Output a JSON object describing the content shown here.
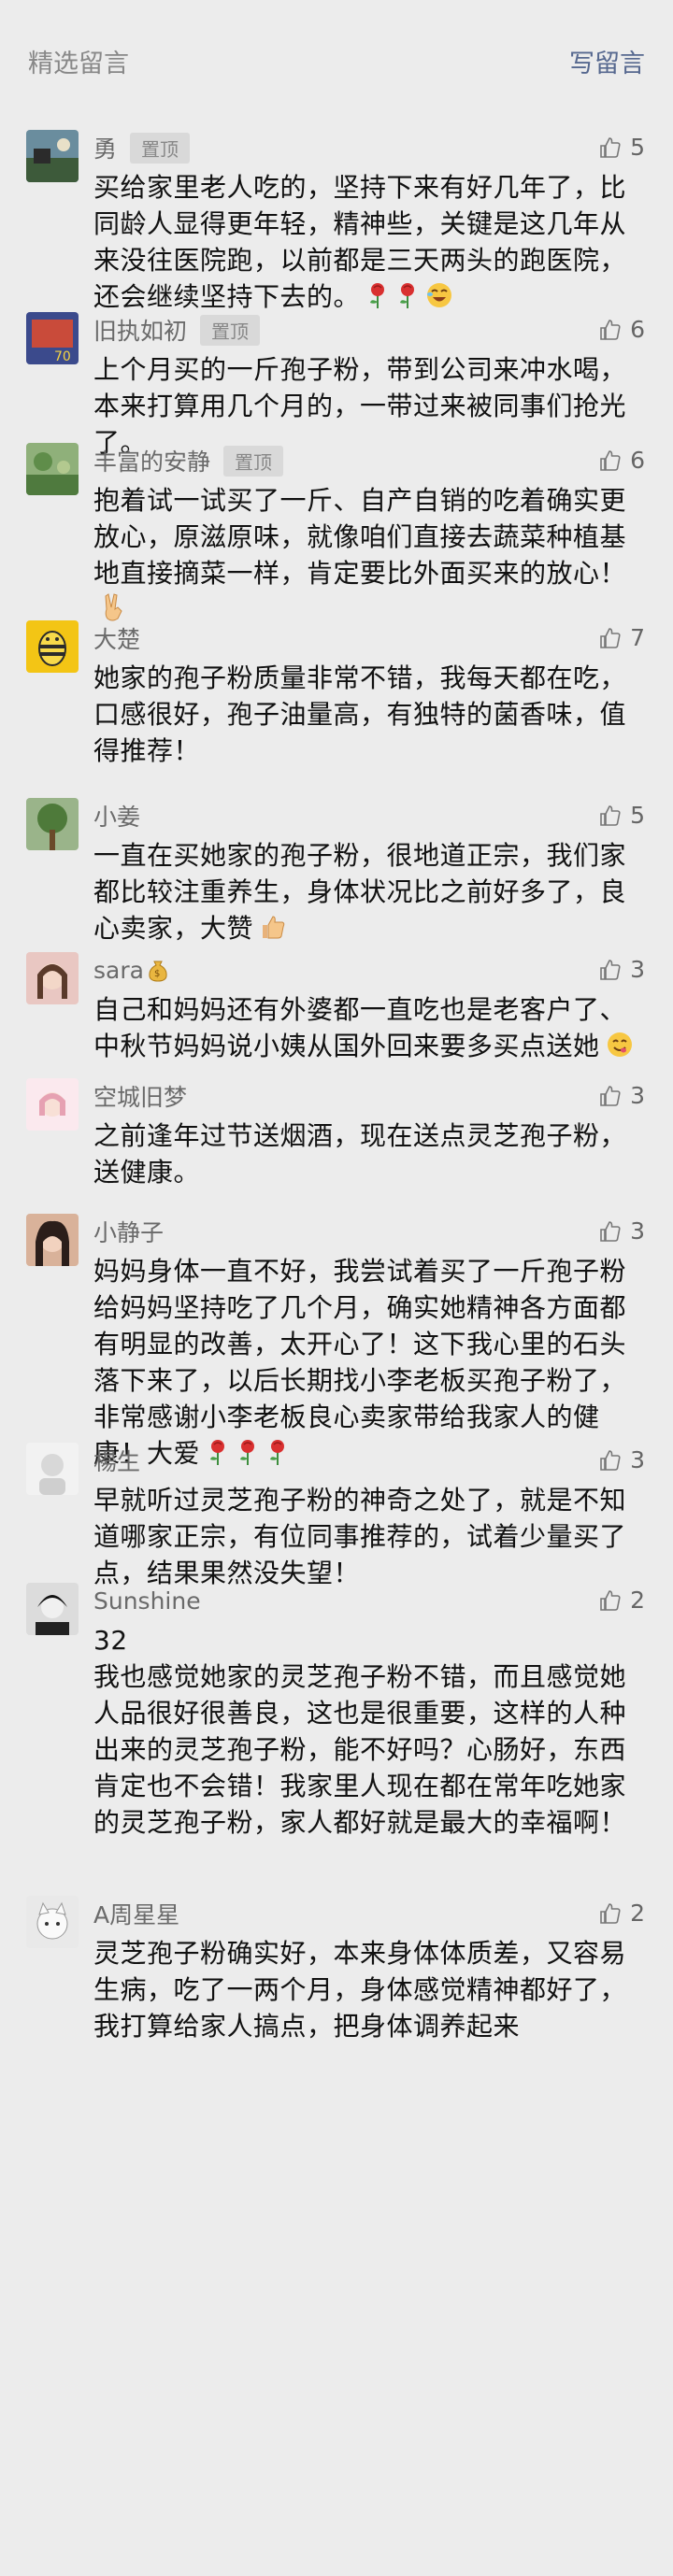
{
  "header": {
    "title": "精选留言",
    "write": "写留言"
  },
  "comments": [
    {
      "name": "勇",
      "pinned": "置顶",
      "likes": "5",
      "text": "买给家里老人吃的，坚持下来有好几年了，比同龄人显得更年轻，精神些，关键是这几年从来没往医院跑，以前都是三天两头的跑医院，还会继续坚持下去的。",
      "avatar": "avatar-landscape-icon",
      "emojis": [
        "rose-icon",
        "rose-icon",
        "laugh-icon"
      ]
    },
    {
      "name": "旧执如初",
      "pinned": "置顶",
      "likes": "6",
      "text": "上个月买的一斤孢子粉，带到公司来冲水喝，本来打算用几个月的，一带过来被同事们抢光了。",
      "avatar": "avatar-game-icon",
      "emojis": []
    },
    {
      "name": "丰富的安静",
      "pinned": "置顶",
      "likes": "6",
      "text": "抱着试一试买了一斤、自产自销的吃着确实更放心，原滋原味，就像咱们直接去蔬菜种植基地直接摘菜一样，肯定要比外面买来的放心！",
      "avatar": "avatar-garden-icon",
      "emojis": [
        "victory-hand-icon"
      ]
    },
    {
      "name": "大楚",
      "pinned": "",
      "likes": "7",
      "text": "她家的孢子粉质量非常不错，我每天都在吃，口感很好，孢子油量高，有独特的菌香味，值得推荐！",
      "avatar": "avatar-bee-icon",
      "emojis": []
    },
    {
      "name": "小姜",
      "pinned": "",
      "likes": "5",
      "text": "一直在买她家的孢子粉，很地道正宗，我们家都比较注重养生，身体状况比之前好多了，良心卖家，大赞",
      "avatar": "avatar-tree-icon",
      "emojis": [
        "thumbs-up-icon"
      ]
    },
    {
      "name": "sara",
      "pinned": "",
      "likes": "3",
      "text": "自己和妈妈还有外婆都一直吃也是老客户了、中秋节妈妈说小姨从国外回来要多买点送她",
      "avatar": "avatar-girl-icon",
      "emojis": [
        "yum-face-icon"
      ],
      "name_emoji": "money-bag-icon"
    },
    {
      "name": "空城旧梦",
      "pinned": "",
      "likes": "3",
      "text": "之前逢年过节送烟酒，现在送点灵芝孢子粉，送健康。",
      "avatar": "avatar-pink-girl-icon",
      "emojis": []
    },
    {
      "name": "小静子",
      "pinned": "",
      "likes": "3",
      "text": "妈妈身体一直不好，我尝试着买了一斤孢子粉给妈妈坚持吃了几个月，确实她精神各方面都有明显的改善，太开心了！这下我心里的石头落下来了，以后长期找小李老板买孢子粉了，非常感谢小李老板良心卖家带给我家人的健康！大爱",
      "avatar": "avatar-woman-icon",
      "emojis": [
        "rose-icon",
        "rose-icon",
        "rose-icon"
      ]
    },
    {
      "name": "楊生",
      "pinned": "",
      "likes": "3",
      "text": "早就听过灵芝孢子粉的神奇之处了，就是不知道哪家正宗，有位同事推荐的，试着少量买了点，结果果然没失望！",
      "avatar": "avatar-white-icon",
      "emojis": []
    },
    {
      "name": "Sunshine",
      "pinned": "",
      "likes": "2",
      "text": "32\n我也感觉她家的灵芝孢子粉不错，而且感觉她人品很好很善良，这也是很重要，这样的人种出来的灵芝孢子粉，能不好吗？心肠好，东西肯定也不会错！我家里人现在都在常年吃她家的灵芝孢子粉，家人都好就是最大的幸福啊！",
      "avatar": "avatar-bw-girl-icon",
      "emojis": []
    },
    {
      "name": "A周星星",
      "pinned": "",
      "likes": "2",
      "text": "灵芝孢子粉确实好，本来身体体质差，又容易生病，吃了一两个月，身体感觉精神都好了，我打算给家人搞点，把身体调养起来",
      "avatar": "avatar-cat-icon",
      "emojis": []
    }
  ],
  "colors": {
    "background": "#ececec",
    "link": "#56688f",
    "meta": "#888888",
    "pin_bg": "#d9d9d9"
  }
}
